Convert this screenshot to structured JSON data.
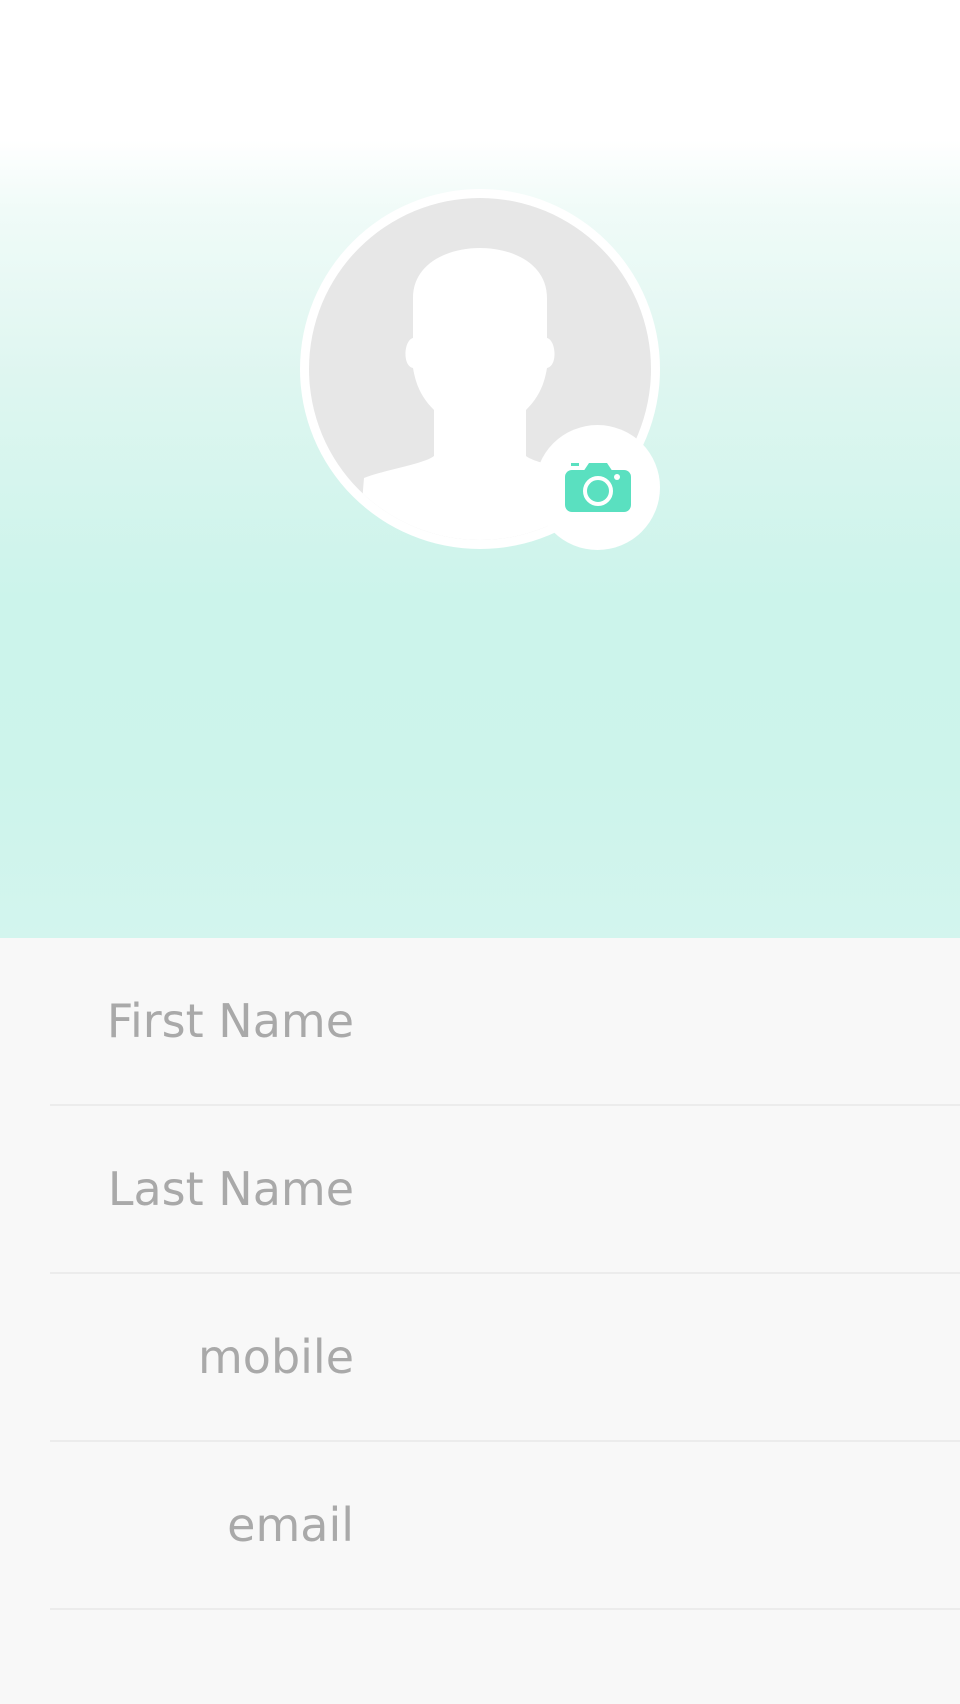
{
  "profile": {
    "avatar_icon": "person-silhouette-icon",
    "camera_icon": "camera-icon",
    "accent_color": "#5ae0c0",
    "header_color": "#ccf4eb"
  },
  "form": {
    "fields": [
      {
        "label": "First Name",
        "value": ""
      },
      {
        "label": "Last Name",
        "value": ""
      },
      {
        "label": "mobile",
        "value": ""
      },
      {
        "label": "email",
        "value": ""
      }
    ]
  }
}
